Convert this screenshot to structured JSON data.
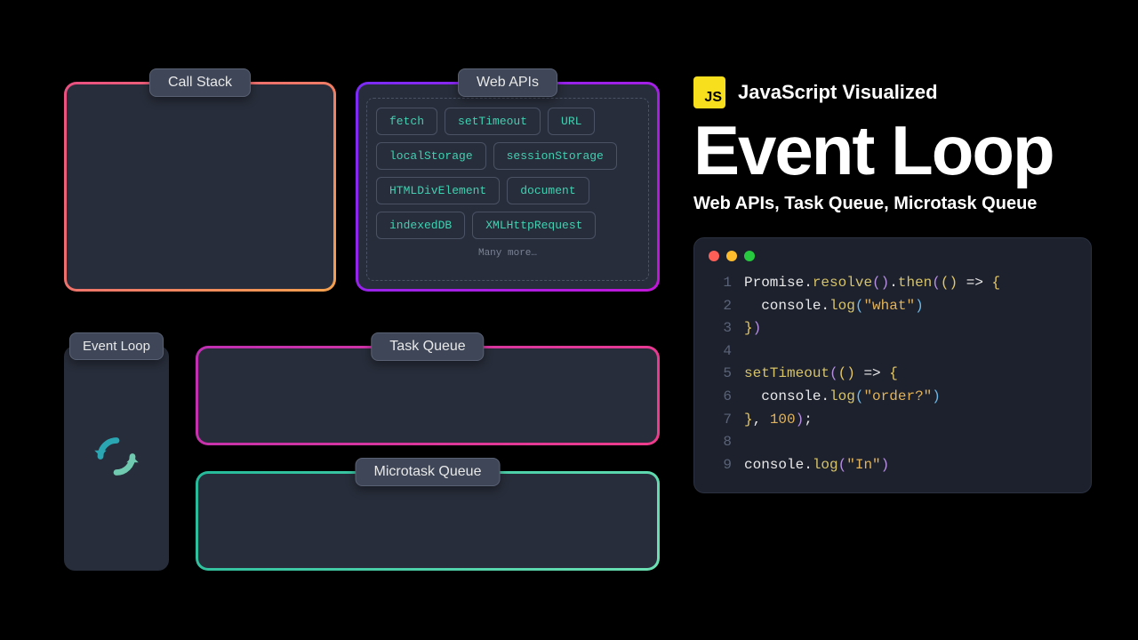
{
  "panels": {
    "call_stack": {
      "label": "Call Stack"
    },
    "web_apis": {
      "label": "Web APIs",
      "items": [
        "fetch",
        "setTimeout",
        "URL",
        "localStorage",
        "sessionStorage",
        "HTMLDivElement",
        "document",
        "indexedDB",
        "XMLHttpRequest"
      ],
      "more": "Many more…"
    },
    "task_queue": {
      "label": "Task Queue"
    },
    "microtask_queue": {
      "label": "Microtask Queue"
    },
    "event_loop": {
      "label": "Event Loop"
    }
  },
  "right": {
    "js_badge": "JS",
    "brand": "JavaScript Visualized",
    "headline": "Event Loop",
    "subhead": "Web APIs, Task Queue, Microtask Queue"
  },
  "code": {
    "lines": [
      [
        {
          "t": "Promise",
          "c": "tok-id"
        },
        {
          "t": ".",
          "c": "tok-pun"
        },
        {
          "t": "resolve",
          "c": "tok-fn"
        },
        {
          "t": "(",
          "c": "tok-par"
        },
        {
          "t": ")",
          "c": "tok-par"
        },
        {
          "t": ".",
          "c": "tok-pun"
        },
        {
          "t": "then",
          "c": "tok-fn"
        },
        {
          "t": "(",
          "c": "tok-par"
        },
        {
          "t": "(",
          "c": "tok-par2"
        },
        {
          "t": ")",
          "c": "tok-par2"
        },
        {
          "t": " => ",
          "c": "tok-pun"
        },
        {
          "t": "{",
          "c": "tok-par2"
        }
      ],
      [
        {
          "t": "  ",
          "c": "tok-pun"
        },
        {
          "t": "console",
          "c": "tok-id"
        },
        {
          "t": ".",
          "c": "tok-pun"
        },
        {
          "t": "log",
          "c": "tok-fn"
        },
        {
          "t": "(",
          "c": "tok-par3"
        },
        {
          "t": "\"what\"",
          "c": "tok-str"
        },
        {
          "t": ")",
          "c": "tok-par3"
        }
      ],
      [
        {
          "t": "}",
          "c": "tok-par2"
        },
        {
          "t": ")",
          "c": "tok-par"
        }
      ],
      [
        {
          "t": "",
          "c": "tok-pun"
        }
      ],
      [
        {
          "t": "setTimeout",
          "c": "tok-fn"
        },
        {
          "t": "(",
          "c": "tok-par"
        },
        {
          "t": "(",
          "c": "tok-par2"
        },
        {
          "t": ")",
          "c": "tok-par2"
        },
        {
          "t": " => ",
          "c": "tok-pun"
        },
        {
          "t": "{",
          "c": "tok-par2"
        }
      ],
      [
        {
          "t": "  ",
          "c": "tok-pun"
        },
        {
          "t": "console",
          "c": "tok-id"
        },
        {
          "t": ".",
          "c": "tok-pun"
        },
        {
          "t": "log",
          "c": "tok-fn"
        },
        {
          "t": "(",
          "c": "tok-par3"
        },
        {
          "t": "\"order?\"",
          "c": "tok-str"
        },
        {
          "t": ")",
          "c": "tok-par3"
        }
      ],
      [
        {
          "t": "}",
          "c": "tok-par2"
        },
        {
          "t": ", ",
          "c": "tok-pun"
        },
        {
          "t": "100",
          "c": "tok-num"
        },
        {
          "t": ")",
          "c": "tok-par"
        },
        {
          "t": ";",
          "c": "tok-pun"
        }
      ],
      [
        {
          "t": "",
          "c": "tok-pun"
        }
      ],
      [
        {
          "t": "console",
          "c": "tok-id"
        },
        {
          "t": ".",
          "c": "tok-pun"
        },
        {
          "t": "log",
          "c": "tok-fn"
        },
        {
          "t": "(",
          "c": "tok-par"
        },
        {
          "t": "\"In\"",
          "c": "tok-str"
        },
        {
          "t": ")",
          "c": "tok-par"
        }
      ]
    ]
  }
}
